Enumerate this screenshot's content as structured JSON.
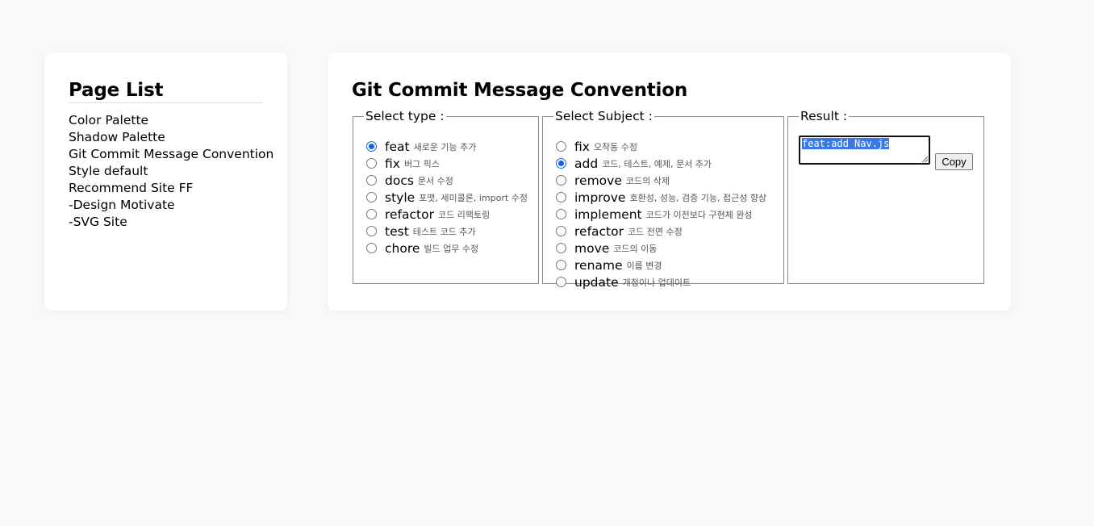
{
  "sidebar": {
    "title": "Page List",
    "items": [
      "Color Palette",
      "Shadow Palette",
      "Git Commit Message Convention",
      "Style default",
      "Recommend Site FF",
      "-Design Motivate",
      "-SVG Site"
    ]
  },
  "main": {
    "title": "Git Commit Message Convention",
    "type_group": {
      "legend": "Select type :",
      "selected": "feat",
      "options": [
        {
          "name": "feat",
          "desc": "새로운 기능 추가",
          "checked": true
        },
        {
          "name": "fix",
          "desc": "버그 픽스",
          "checked": false
        },
        {
          "name": "docs",
          "desc": "문서 수정",
          "checked": false
        },
        {
          "name": "style",
          "desc": "포맷, 세미콜론, import 수정",
          "checked": false
        },
        {
          "name": "refactor",
          "desc": "코드 리팩토링",
          "checked": false
        },
        {
          "name": "test",
          "desc": "테스트 코드 추가",
          "checked": false
        },
        {
          "name": "chore",
          "desc": "빌드 업무 수정",
          "checked": false
        }
      ]
    },
    "subject_group": {
      "legend": "Select Subject :",
      "selected": "add",
      "options": [
        {
          "name": "fix",
          "desc": "오작동 수정",
          "checked": false
        },
        {
          "name": "add",
          "desc": "코드, 테스트, 예제, 문서 추가",
          "checked": true
        },
        {
          "name": "remove",
          "desc": "코드의 삭제",
          "checked": false
        },
        {
          "name": "improve",
          "desc": "호환성, 성능, 검증 기능, 접근성 향상",
          "checked": false
        },
        {
          "name": "implement",
          "desc": "코드가 이전보다 구현체 완성",
          "checked": false
        },
        {
          "name": "refactor",
          "desc": "코드 전면 수정",
          "checked": false
        },
        {
          "name": "move",
          "desc": "코드의 이동",
          "checked": false
        },
        {
          "name": "rename",
          "desc": "이름 변경",
          "checked": false
        },
        {
          "name": "update",
          "desc": "개정이나 업데이트",
          "checked": false
        }
      ]
    },
    "result_group": {
      "legend": "Result :",
      "value": "feat:add Nav.js",
      "copy_label": "Copy"
    }
  },
  "colors": {
    "background": "#f8f8f8",
    "card": "#ffffff",
    "radio_checked": "#0a66e8",
    "selection": "#3b78e7"
  }
}
